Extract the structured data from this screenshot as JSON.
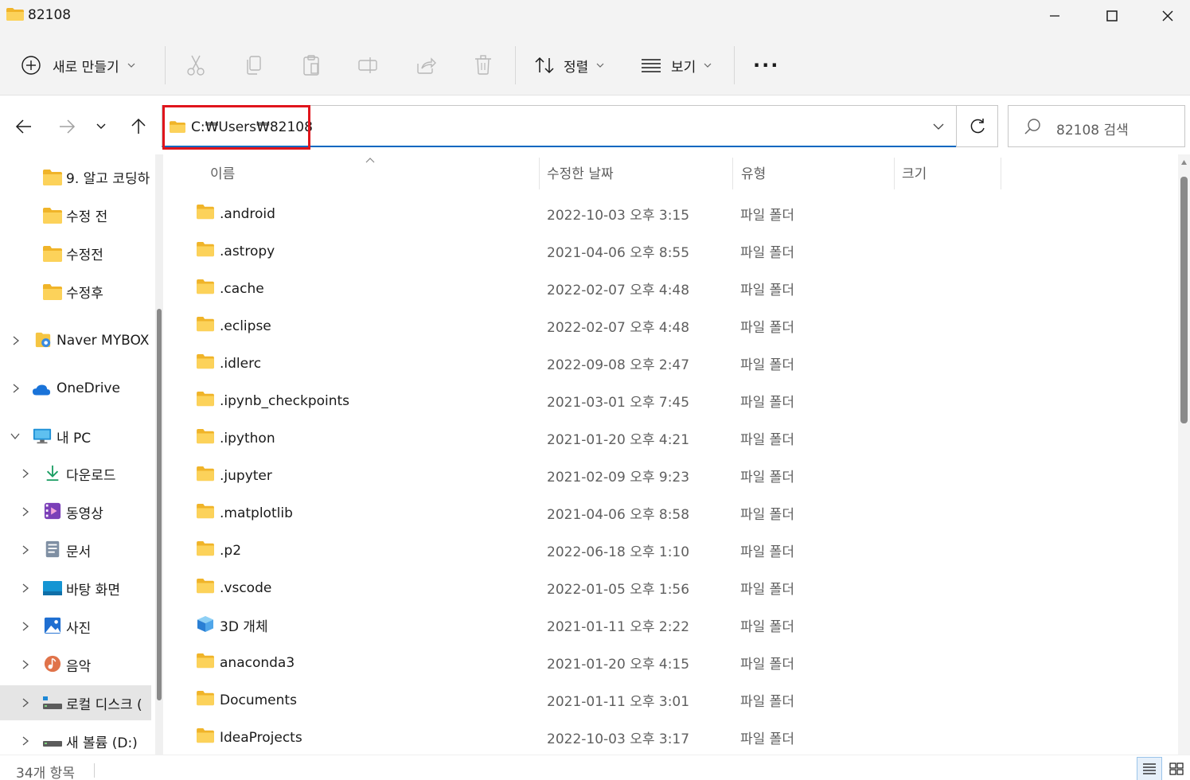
{
  "window": {
    "title": "82108",
    "minimize_icon": "minimize-icon",
    "maximize_icon": "maximize-icon",
    "close_icon": "close-icon"
  },
  "toolbar": {
    "new_label": "새로 만들기",
    "sort_label": "정렬",
    "view_label": "보기",
    "more_label": "..."
  },
  "address": {
    "path": "C:₩Users₩82108",
    "search_placeholder": "82108 검색",
    "highlight_color": "#e0151c"
  },
  "sidebar": {
    "items": [
      {
        "label": "9. 알고 코딩하",
        "icon": "folder-icon"
      },
      {
        "label": "수정 전",
        "icon": "folder-icon"
      },
      {
        "label": "수정전",
        "icon": "folder-icon"
      },
      {
        "label": "수정후",
        "icon": "folder-icon"
      },
      {
        "label": "Naver MYBOX",
        "icon": "mybox-icon"
      },
      {
        "label": "OneDrive",
        "icon": "cloud-icon"
      },
      {
        "label": "내 PC",
        "icon": "pc-icon"
      },
      {
        "label": "다운로드",
        "icon": "download-icon"
      },
      {
        "label": "동영상",
        "icon": "video-icon"
      },
      {
        "label": "문서",
        "icon": "document-icon"
      },
      {
        "label": "바탕 화면",
        "icon": "desktop-icon"
      },
      {
        "label": "사진",
        "icon": "picture-icon"
      },
      {
        "label": "음악",
        "icon": "music-icon"
      },
      {
        "label": "로컬 디스크 (",
        "icon": "drive-icon"
      },
      {
        "label": "새 볼륨 (D:)",
        "icon": "drive-icon"
      }
    ]
  },
  "columns": {
    "name": "이름",
    "date": "수정한 날짜",
    "type": "유형",
    "size": "크기"
  },
  "files": [
    {
      "name": ".android",
      "date": "2022-10-03 오후 3:15",
      "type": "파일 폴더"
    },
    {
      "name": ".astropy",
      "date": "2021-04-06 오후 8:55",
      "type": "파일 폴더"
    },
    {
      "name": ".cache",
      "date": "2022-02-07 오후 4:48",
      "type": "파일 폴더"
    },
    {
      "name": ".eclipse",
      "date": "2022-02-07 오후 4:48",
      "type": "파일 폴더"
    },
    {
      "name": ".idlerc",
      "date": "2022-09-08 오후 2:47",
      "type": "파일 폴더"
    },
    {
      "name": ".ipynb_checkpoints",
      "date": "2021-03-01 오후 7:45",
      "type": "파일 폴더"
    },
    {
      "name": ".ipython",
      "date": "2021-01-20 오후 4:21",
      "type": "파일 폴더"
    },
    {
      "name": ".jupyter",
      "date": "2021-02-09 오후 9:23",
      "type": "파일 폴더"
    },
    {
      "name": ".matplotlib",
      "date": "2021-04-06 오후 8:58",
      "type": "파일 폴더"
    },
    {
      "name": ".p2",
      "date": "2022-06-18 오후 1:10",
      "type": "파일 폴더"
    },
    {
      "name": ".vscode",
      "date": "2022-01-05 오후 1:56",
      "type": "파일 폴더"
    },
    {
      "name": "3D 개체",
      "date": "2021-01-11 오후 2:22",
      "type": "파일 폴더"
    },
    {
      "name": "anaconda3",
      "date": "2021-01-20 오후 4:15",
      "type": "파일 폴더"
    },
    {
      "name": "Documents",
      "date": "2021-01-11 오후 3:01",
      "type": "파일 폴더"
    },
    {
      "name": "IdeaProjects",
      "date": "2022-10-03 오후 3:17",
      "type": "파일 폴더"
    }
  ],
  "status": {
    "item_count": "34개 항목"
  },
  "colors": {
    "folder_yellow": "#f8c93f",
    "accent_blue": "#0067c0"
  }
}
